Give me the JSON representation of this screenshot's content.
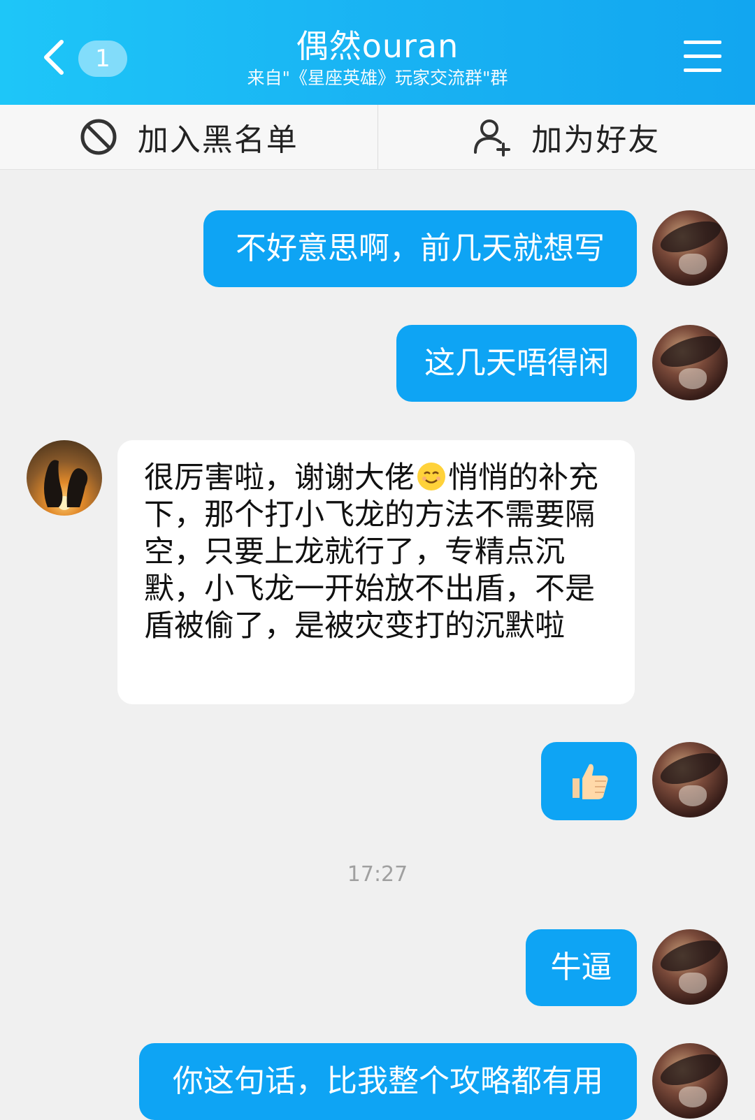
{
  "header": {
    "title": "偶然ouran",
    "subtitle": "来自\"《星座英雄》玩家交流群\"群",
    "unread_count": "1",
    "back_icon": "chevron-left-icon",
    "menu_icon": "hamburger-menu-icon"
  },
  "actions": {
    "blacklist_label": "加入黑名单",
    "add_friend_label": "加为好友"
  },
  "messages": [
    {
      "sender": "me",
      "text": "不好意思啊，前几天就想写"
    },
    {
      "sender": "me",
      "text": "这几天唔得闲"
    },
    {
      "sender": "other",
      "text_before_emoji": "很厉害啦，谢谢大佬",
      "emoji": "smiling-face-emoji",
      "text_after_emoji": "悄悄的补充下，那个打小飞龙的方法不需要隔空，只要上龙就行了，专精点沉默，小飞龙一开始放不出盾，不是盾被偷了，是被灾变打的沉默啦"
    },
    {
      "sender": "me",
      "emoji": "thumbs-up-emoji"
    },
    {
      "sender": "me",
      "text": "牛逼"
    },
    {
      "sender": "me",
      "text": "你这句话，比我整个攻略都有用"
    }
  ],
  "timestamp": "17:27",
  "colors": {
    "header_start": "#1ec6f8",
    "header_end": "#12a6f0",
    "bubble_me": "#0ea4f4",
    "bubble_other": "#ffffff",
    "background": "#f0f0f0"
  }
}
